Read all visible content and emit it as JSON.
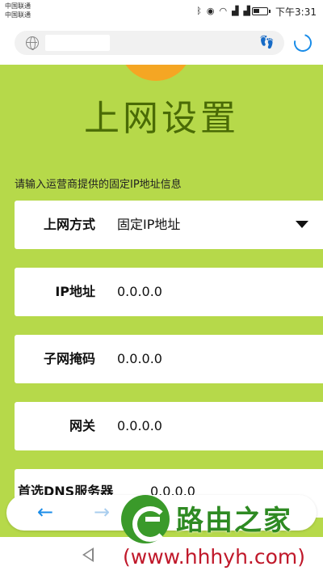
{
  "status_bar": {
    "carrier_1": "中国联通",
    "carrier_2": "中国联通",
    "icons": [
      "bluetooth-icon",
      "eye-icon",
      "wifi-icon",
      "signal-4g-icon",
      "signal-2g-icon",
      "battery-icon"
    ],
    "time": "下午3:31"
  },
  "address_bar": {
    "url": ""
  },
  "page": {
    "title": "上网设置",
    "instruction": "请输入运营商提供的固定IP地址信息",
    "fields": [
      {
        "label": "上网方式",
        "value": "固定IP地址",
        "type": "dropdown"
      },
      {
        "label": "IP地址",
        "value": "0.0.0.0"
      },
      {
        "label": "子网掩码",
        "value": "0.0.0.0"
      },
      {
        "label": "网关",
        "value": "0.0.0.0"
      },
      {
        "label": "首选DNS服务器",
        "value": "0.0.0.0"
      }
    ]
  },
  "watermark": {
    "brand": "路由之家",
    "url": "(www.hhhyh.com)"
  },
  "colors": {
    "background": "#b6d94a",
    "title": "#4a6b06",
    "accent": "#1a8ce8",
    "watermark_green": "#2e8a22",
    "watermark_red": "#c0182a"
  }
}
